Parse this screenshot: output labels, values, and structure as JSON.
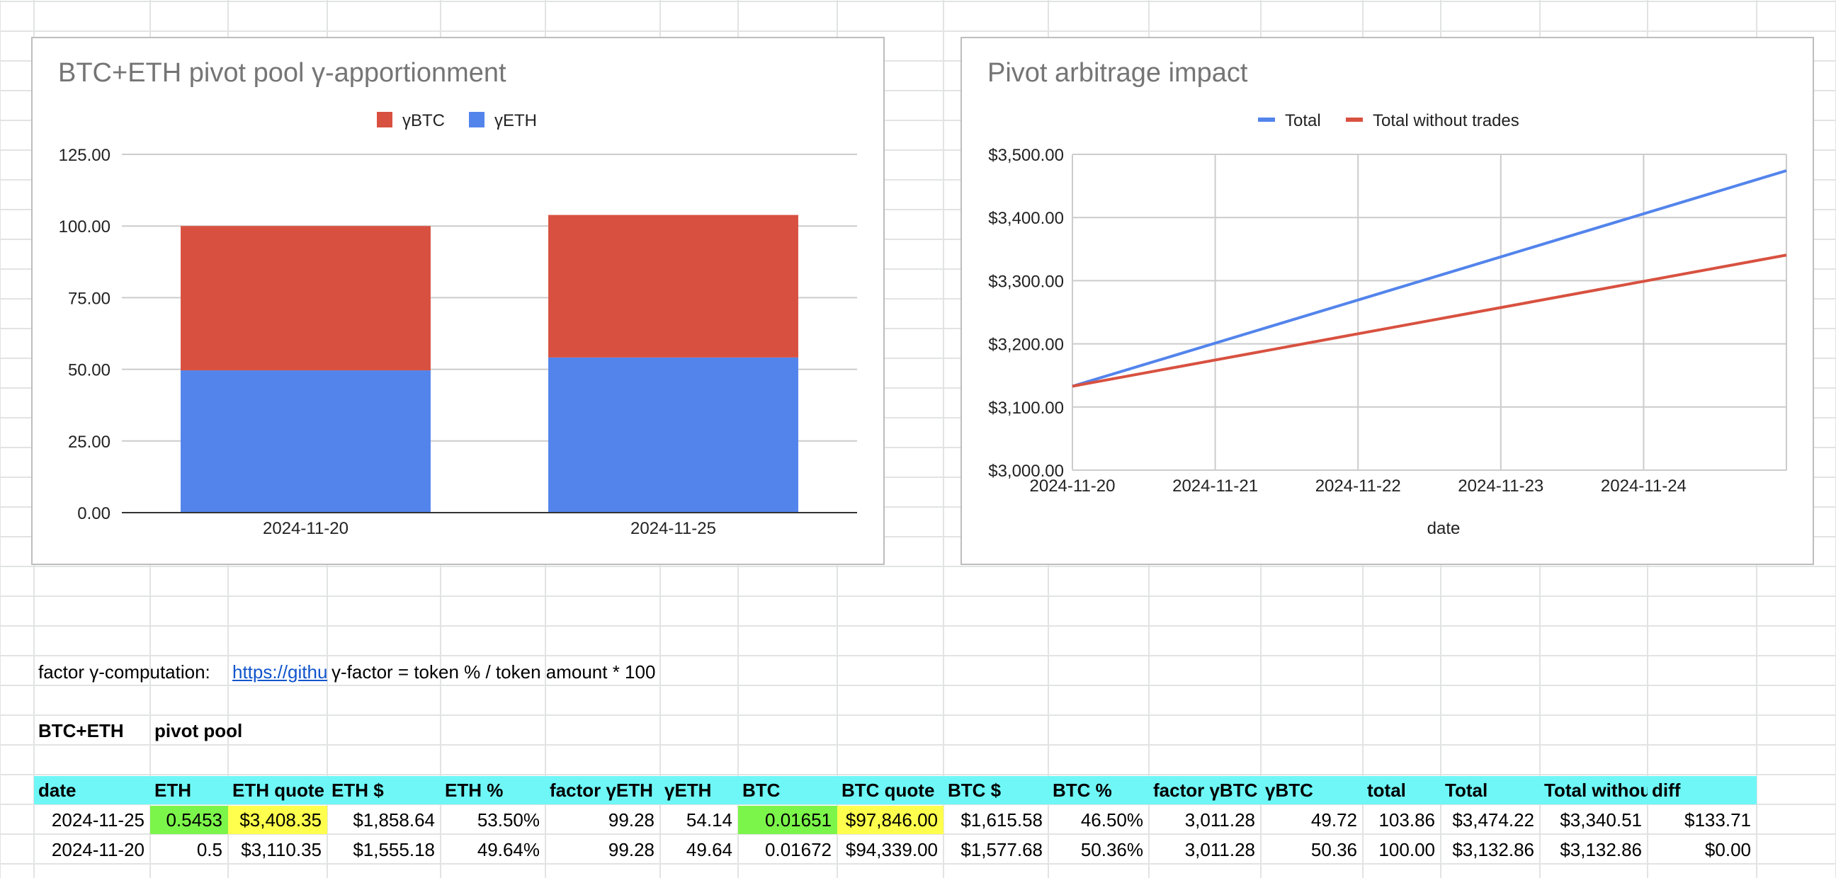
{
  "grid": {
    "line_color": "#e2e3e3",
    "header_fill": "#6ff7f7",
    "green_fill": "#7cf54a",
    "yellow_fill": "#ffff4d"
  },
  "formula_row": {
    "label": "factor γ-computation:",
    "link": "https://githu",
    "formula": "γ-factor = token % / token amount * 100"
  },
  "pool_row": {
    "pair": "BTC+ETH",
    "name": "pivot pool"
  },
  "table": {
    "columns": [
      "date",
      "ETH",
      "ETH quote",
      "ETH $",
      "ETH %",
      "factor γETH",
      "γETH",
      "BTC",
      "BTC quote",
      "BTC $",
      "BTC %",
      "factor γBTC",
      "γBTC",
      "total",
      "Total",
      "Total withou",
      "diff"
    ],
    "rows": [
      [
        "2024-11-25",
        "0.5453",
        "$3,408.35",
        "$1,858.64",
        "53.50%",
        "99.28",
        "54.14",
        "0.01651",
        "$97,846.00",
        "$1,615.58",
        "46.50%",
        "3,011.28",
        "49.72",
        "103.86",
        "$3,474.22",
        "$3,340.51",
        "$133.71"
      ],
      [
        "2024-11-20",
        "0.5",
        "$3,110.35",
        "$1,555.18",
        "49.64%",
        "99.28",
        "49.64",
        "0.01672",
        "$94,339.00",
        "$1,577.68",
        "50.36%",
        "3,011.28",
        "50.36",
        "100.00",
        "$3,132.86",
        "$3,132.86",
        "$0.00"
      ]
    ]
  },
  "chart_data": [
    {
      "type": "bar",
      "stacked": true,
      "title": "BTC+ETH pivot pool γ-apportionment",
      "categories": [
        "2024-11-20",
        "2024-11-25"
      ],
      "series": [
        {
          "name": "γETH",
          "values": [
            49.64,
            54.14
          ],
          "color": "#5384ec"
        },
        {
          "name": "γBTC",
          "values": [
            50.36,
            49.72
          ],
          "color": "#d85140"
        }
      ],
      "legend": [
        "γBTC",
        "γETH"
      ],
      "legend_position": "top",
      "ylim": [
        0,
        125
      ],
      "yticks": [
        0,
        25,
        50,
        75,
        100,
        125
      ],
      "ytick_labels": [
        "0.00",
        "25.00",
        "50.00",
        "75.00",
        "100.00",
        "125.00"
      ],
      "xlabel": "",
      "ylabel": "",
      "grid": true
    },
    {
      "type": "line",
      "title": "Pivot arbitrage impact",
      "xlabel": "date",
      "x": [
        "2024-11-20",
        "2024-11-25"
      ],
      "xticks": [
        "2024-11-20",
        "2024-11-21",
        "2024-11-22",
        "2024-11-23",
        "2024-11-24"
      ],
      "series": [
        {
          "name": "Total",
          "values": [
            3132.86,
            3474.22
          ],
          "color": "#5384ec"
        },
        {
          "name": "Total without trades",
          "values": [
            3132.86,
            3340.51
          ],
          "color": "#d85140"
        }
      ],
      "legend_position": "top",
      "ylim": [
        3000,
        3500
      ],
      "yticks": [
        3000,
        3100,
        3200,
        3300,
        3400,
        3500
      ],
      "ytick_labels": [
        "$3,000.00",
        "$3,100.00",
        "$3,200.00",
        "$3,300.00",
        "$3,400.00",
        "$3,500.00"
      ],
      "grid": true
    }
  ]
}
